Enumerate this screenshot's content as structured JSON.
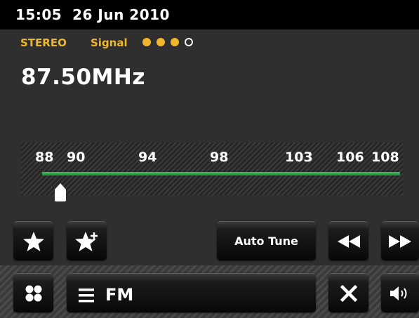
{
  "header": {
    "time": "15:05",
    "date": "26 Jun 2010"
  },
  "status": {
    "mode": "STEREO",
    "signal_label": "Signal",
    "signal_strength": 3,
    "signal_max": 4,
    "accent_color": "#f0b62c"
  },
  "frequency": {
    "display": "87.50MHz"
  },
  "tuning_scale": {
    "ticks": [
      "88",
      "90",
      "94",
      "98",
      "103",
      "106",
      "108"
    ],
    "line_color": "#2ea84a",
    "marker_value": "87.50"
  },
  "buttons": {
    "favorite_icon": "star-icon",
    "add_favorite_icon": "star-plus-icon",
    "auto_tune_label": "Auto Tune",
    "rewind_icon": "rewind-icon",
    "fast_forward_icon": "fast-forward-icon",
    "home_icon": "home-dots-icon",
    "menu_icon": "menu-icon",
    "source_label": "FM",
    "close_icon": "close-icon",
    "volume_icon": "volume-icon"
  }
}
